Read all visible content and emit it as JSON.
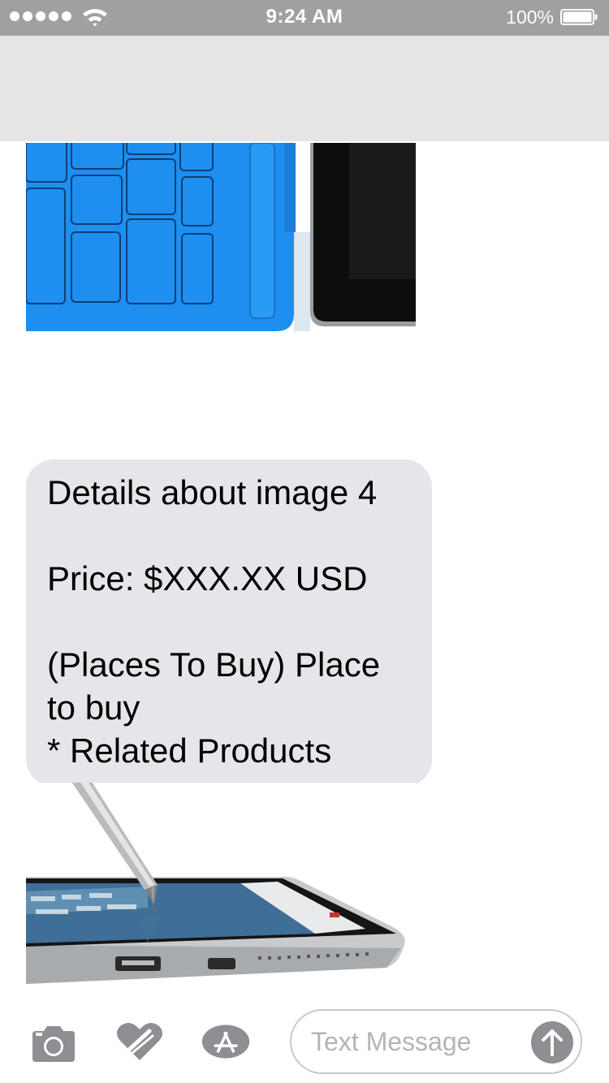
{
  "status_bar": {
    "time": "9:24 AM",
    "battery_percent": "100%",
    "signal_bars": 5,
    "icons": [
      "signal-icon",
      "wifi-icon",
      "battery-icon"
    ]
  },
  "thread": {
    "messages": [
      {
        "type": "image",
        "icon": "surface-keyboard-image"
      },
      {
        "type": "text",
        "lines": [
          "Details about image 4",
          "",
          "Price: $XXX.XX USD",
          "",
          "(Places To Buy) Place",
          "to buy",
          "* Related Products"
        ]
      },
      {
        "type": "image",
        "icon": "surface-pen-tablet-image"
      }
    ]
  },
  "input_bar": {
    "placeholder": "Text Message",
    "value": "",
    "icons": [
      "camera-icon",
      "digital-touch-icon",
      "app-store-icon",
      "send-arrow-icon"
    ]
  },
  "colors": {
    "status_bar_bg": "#a0a0a0",
    "nav_bg": "#e5e5e5",
    "incoming_bubble": "#e5e5ea",
    "icon_gray": "#8e8e93",
    "keyboard_blue": "#1e8fef"
  }
}
